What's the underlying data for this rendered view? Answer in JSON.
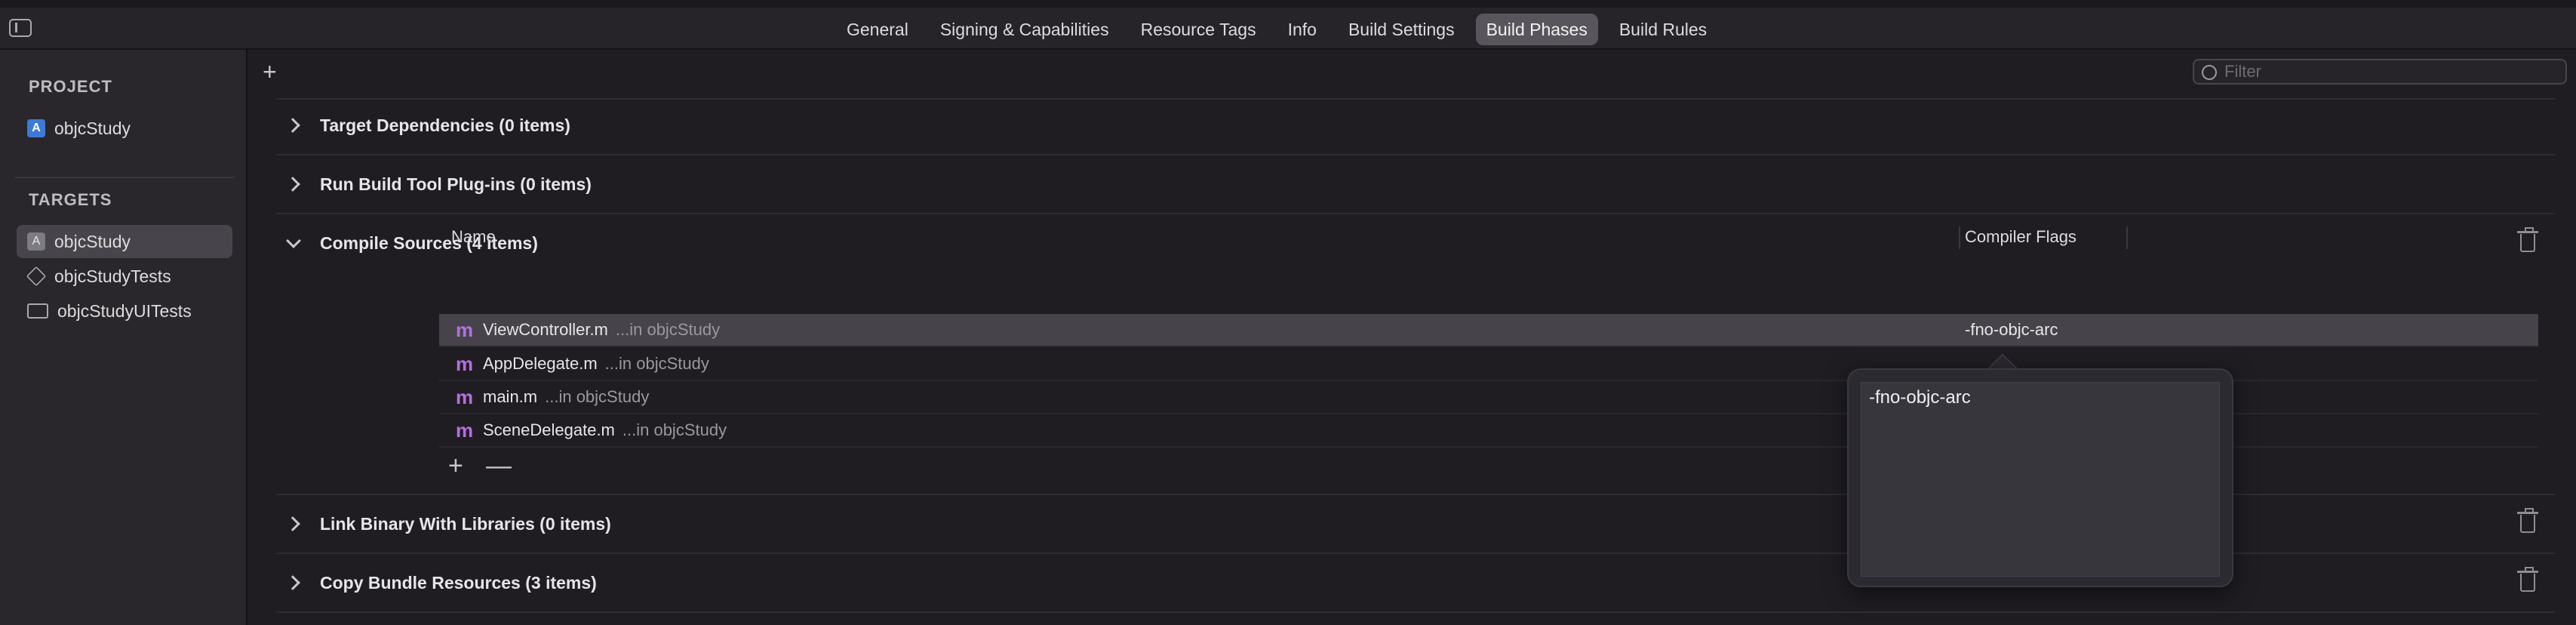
{
  "tabbar": {
    "tabs": [
      {
        "label": "General",
        "active": false
      },
      {
        "label": "Signing & Capabilities",
        "active": false
      },
      {
        "label": "Resource Tags",
        "active": false
      },
      {
        "label": "Info",
        "active": false
      },
      {
        "label": "Build Settings",
        "active": false
      },
      {
        "label": "Build Phases",
        "active": true
      },
      {
        "label": "Build Rules",
        "active": false
      }
    ]
  },
  "sidebar": {
    "project_heading": "PROJECT",
    "project_item": "objcStudy",
    "targets_heading": "TARGETS",
    "targets": [
      {
        "label": "objcStudy",
        "icon": "app-target-icon",
        "selected": true
      },
      {
        "label": "objcStudyTests",
        "icon": "unit-test-target-icon",
        "selected": false
      },
      {
        "label": "objcStudyUITests",
        "icon": "ui-test-target-icon",
        "selected": false
      }
    ]
  },
  "main": {
    "add_button": "+",
    "filter_placeholder": "Filter",
    "phases": {
      "target_dependencies": "Target Dependencies (0 items)",
      "run_build_tool_plugins": "Run Build Tool Plug-ins (0 items)",
      "compile_sources": "Compile Sources (4 items)",
      "link_binary": "Link Binary With Libraries (0 items)",
      "copy_bundle_resources": "Copy Bundle Resources (3 items)"
    },
    "compile_table": {
      "columns": {
        "name": "Name",
        "flags": "Compiler Flags"
      },
      "rows": [
        {
          "icon": "m",
          "name": "ViewController.m",
          "location": "...in objcStudy",
          "flags": "-fno-objc-arc",
          "selected": true
        },
        {
          "icon": "m",
          "name": "AppDelegate.m",
          "location": "...in objcStudy",
          "flags": "",
          "selected": false
        },
        {
          "icon": "m",
          "name": "main.m",
          "location": "...in objcStudy",
          "flags": "",
          "selected": false
        },
        {
          "icon": "m",
          "name": "SceneDelegate.m",
          "location": "...in objcStudy",
          "flags": "",
          "selected": false
        }
      ],
      "add_label": "+",
      "remove_label": "—"
    },
    "flags_popover": {
      "value": "-fno-objc-arc"
    }
  },
  "colors": {
    "accent_active_tab": "#58565c",
    "file_icon_purple": "#b46fe0",
    "selected_row": "#46444a"
  }
}
